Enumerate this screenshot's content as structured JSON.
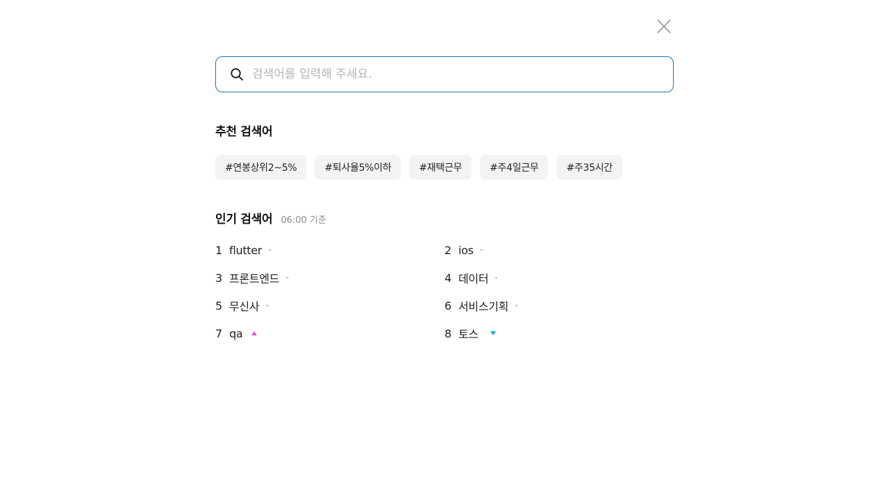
{
  "search": {
    "placeholder": "검색어를 입력해 주세요.",
    "value": ""
  },
  "recommended": {
    "title": "추천 검색어",
    "tags": [
      "#연봉상위2~5%",
      "#퇴사율5%이하",
      "#재택근무",
      "#주4일근무",
      "#주35시간"
    ]
  },
  "popular": {
    "title": "인기 검색어",
    "timestamp": "06:00 기준",
    "items": [
      {
        "rank": "1",
        "keyword": "flutter",
        "trend": "-",
        "trend_type": "same"
      },
      {
        "rank": "2",
        "keyword": "ios",
        "trend": "-",
        "trend_type": "same"
      },
      {
        "rank": "3",
        "keyword": "프론트엔드",
        "trend": "-",
        "trend_type": "same"
      },
      {
        "rank": "4",
        "keyword": "데이터",
        "trend": "-",
        "trend_type": "same"
      },
      {
        "rank": "5",
        "keyword": "무신사",
        "trend": "-",
        "trend_type": "same"
      },
      {
        "rank": "6",
        "keyword": "서비스기획",
        "trend": "-",
        "trend_type": "same"
      },
      {
        "rank": "7",
        "keyword": "qa",
        "trend": "",
        "trend_type": "up"
      },
      {
        "rank": "8",
        "keyword": "토스",
        "trend": "",
        "trend_type": "down"
      }
    ]
  },
  "colors": {
    "accent": "#1a6fcf",
    "trend_up": "#ee55cc",
    "trend_down": "#1ba9e8"
  },
  "icons": {
    "close": "close-icon",
    "search": "search-icon"
  }
}
